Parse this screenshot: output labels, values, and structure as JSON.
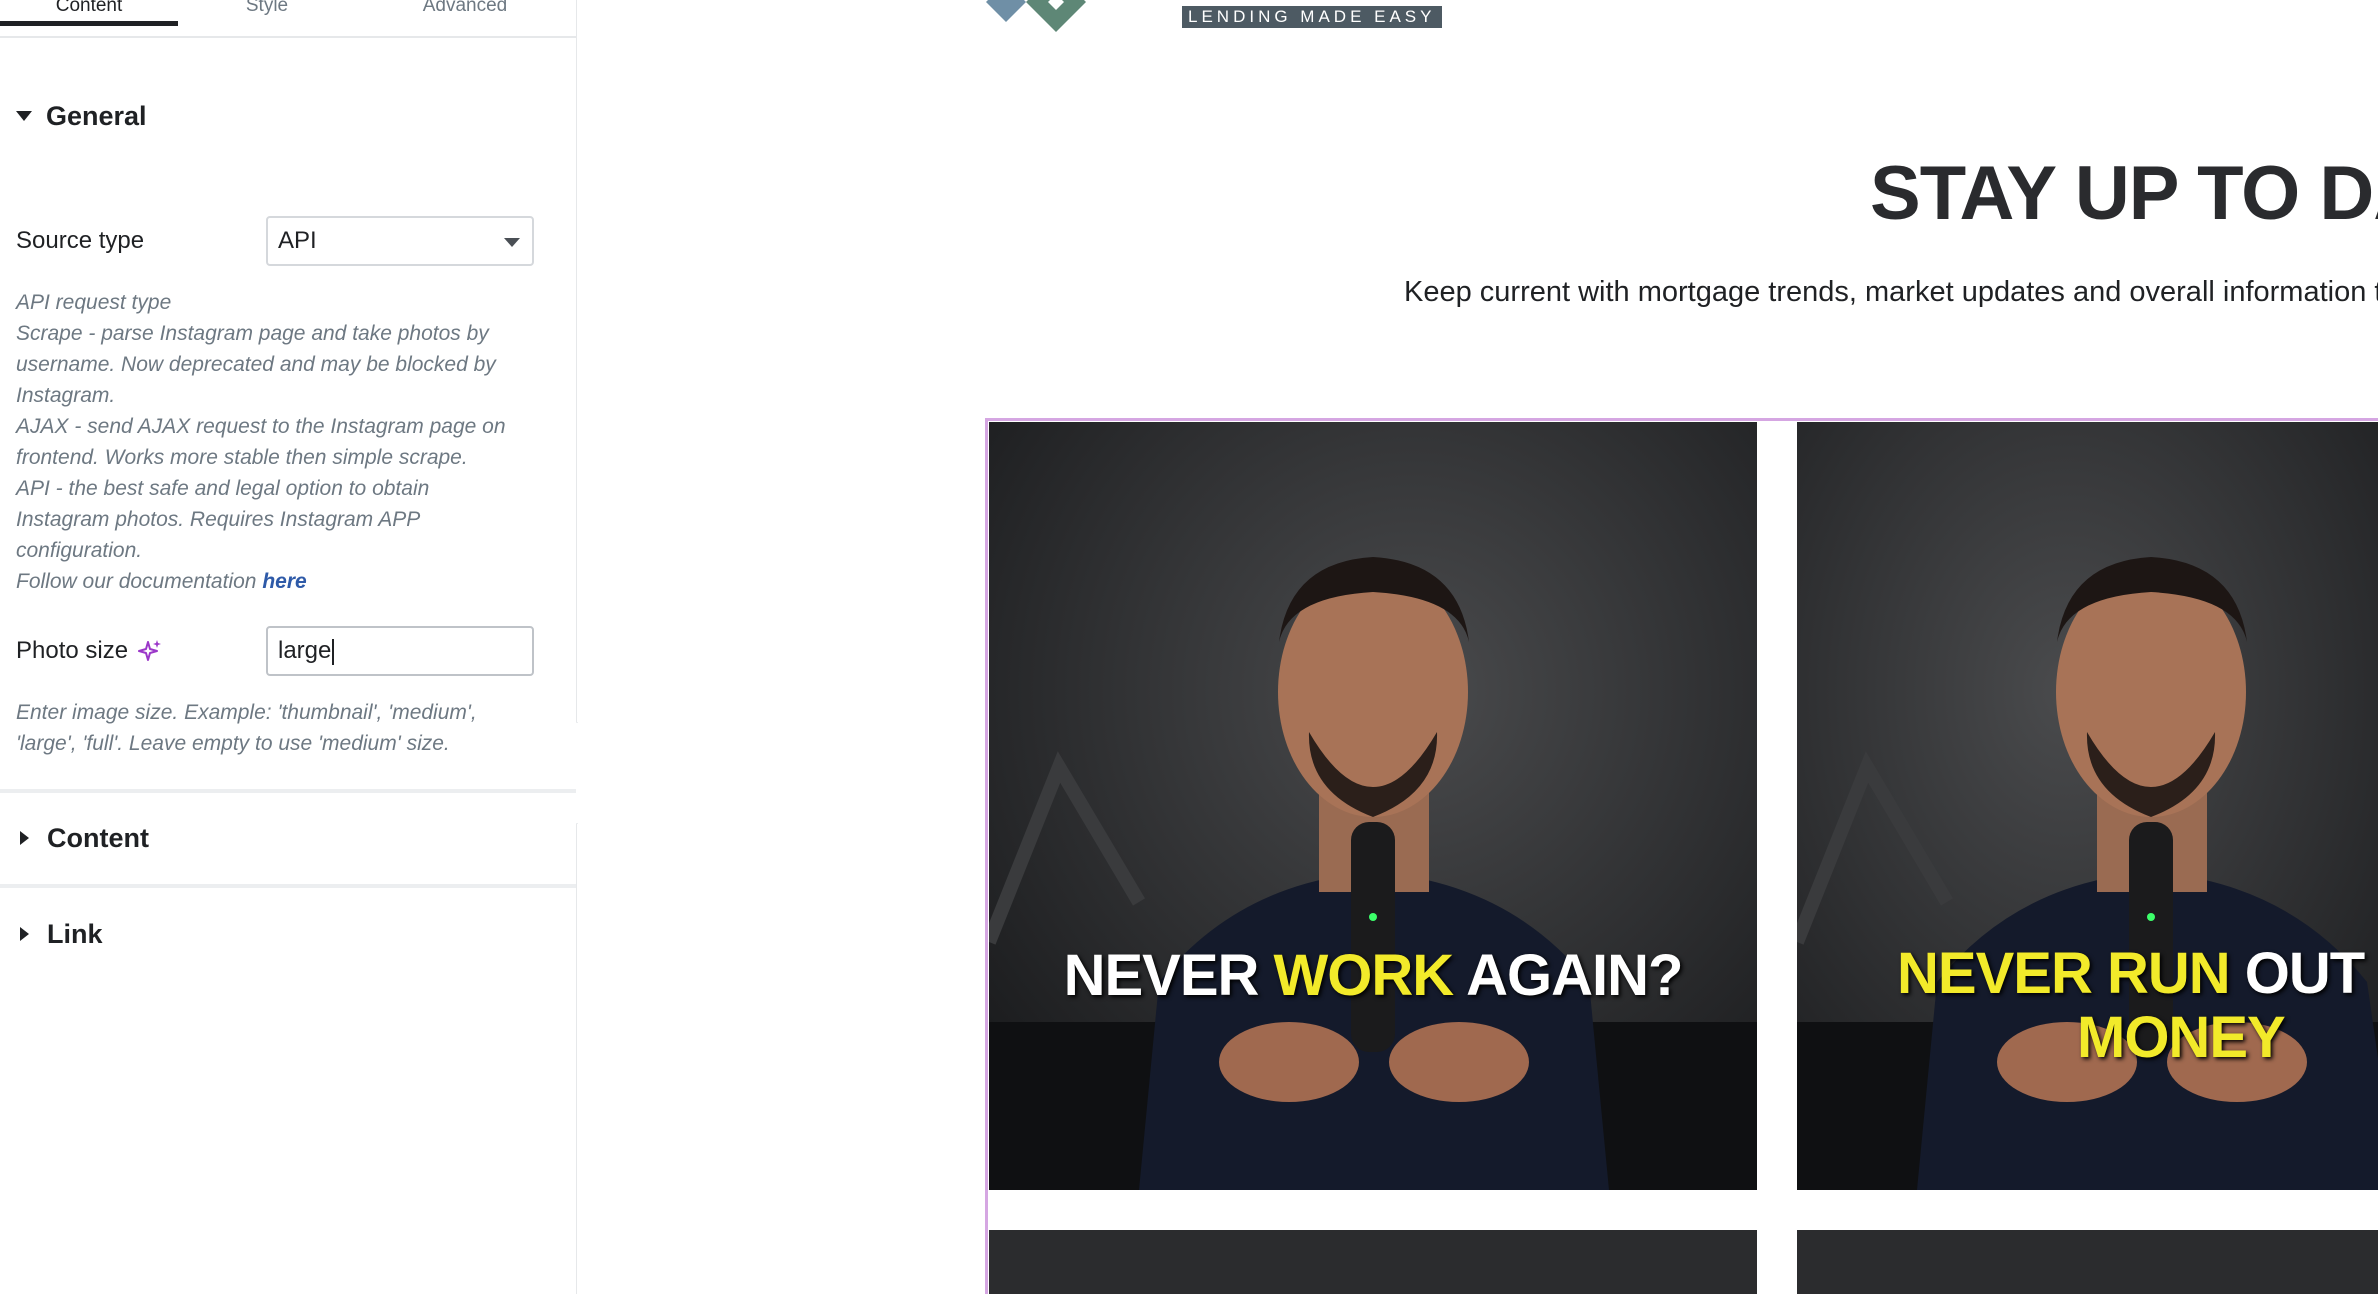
{
  "tabs": [
    {
      "label": "Content"
    },
    {
      "label": "Style"
    },
    {
      "label": "Advanced"
    }
  ],
  "general": {
    "title": "General",
    "source_type": {
      "label": "Source type",
      "value": "API"
    },
    "source_help": [
      "API request type",
      "Scrape - parse Instagram page and take photos by",
      "username. Now deprecated and may be blocked by",
      "Instagram.",
      "AJAX - send AJAX request to the Instagram page on",
      "frontend. Works more stable then simple scrape.",
      "API - the best safe and legal option to obtain",
      "Instagram photos. Requires Instagram APP",
      "configuration."
    ],
    "doc_prefix": "Follow our documentation ",
    "doc_link": "here",
    "photo_size": {
      "label": "Photo size",
      "value": "large"
    },
    "photo_help": [
      "Enter image size. Example: 'thumbnail', 'medium',",
      "'large', 'full'. Leave empty to use 'medium' size."
    ]
  },
  "sections": [
    {
      "title": "Content"
    },
    {
      "title": "Link"
    }
  ],
  "preview": {
    "tagline": "LENDING MADE EASY",
    "title": "STAY UP TO DA",
    "subtitle": "Keep current with mortgage trends, market updates and overall information to",
    "photos": [
      {
        "caption_parts": [
          "NEVER ",
          "WORK",
          " AGAIN?"
        ]
      },
      {
        "caption_parts": [
          "NEVER RUN",
          " OUT",
          "MONEY"
        ]
      }
    ]
  },
  "colors": {
    "accent_yellow": "#f2ea2a",
    "selection_outline": "#d5a6e2",
    "link": "#2e5aa8"
  },
  "icons": {
    "ai": "sparkle-icon",
    "collapse": "chevron-left-icon",
    "select": "chevron-down-icon"
  }
}
